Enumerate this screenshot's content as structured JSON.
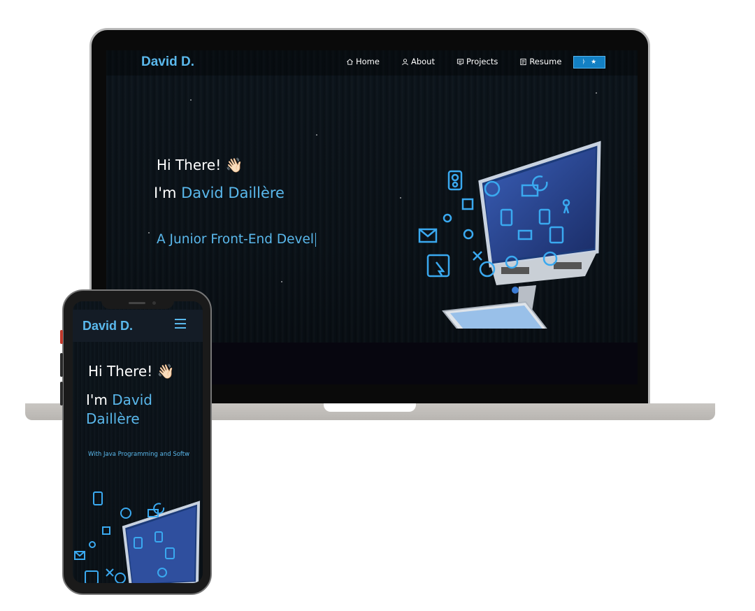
{
  "desktop": {
    "brand": "David D.",
    "nav": [
      {
        "label": "Home",
        "icon": "home-icon"
      },
      {
        "label": "About",
        "icon": "user-icon"
      },
      {
        "label": "Projects",
        "icon": "projects-icon"
      },
      {
        "label": "Resume",
        "icon": "document-icon"
      }
    ],
    "github_button": {
      "icons": [
        "fork-icon",
        "star-icon"
      ]
    },
    "greeting": "Hi There! 👋🏻",
    "intro_prefix": "I'm ",
    "intro_name": "David Daillère",
    "role_typed": "A Junior Front-End Devel"
  },
  "mobile": {
    "brand": "David D.",
    "menu_icon": "hamburger-menu-icon",
    "greeting": "Hi There! 👋🏻",
    "intro_prefix": "I'm ",
    "intro_name": "David Daillère",
    "role_typed": "With Java Programming and Softw"
  },
  "colors": {
    "accent": "#5ab8ec",
    "background": "#0a1117",
    "button": "#1380c4"
  }
}
